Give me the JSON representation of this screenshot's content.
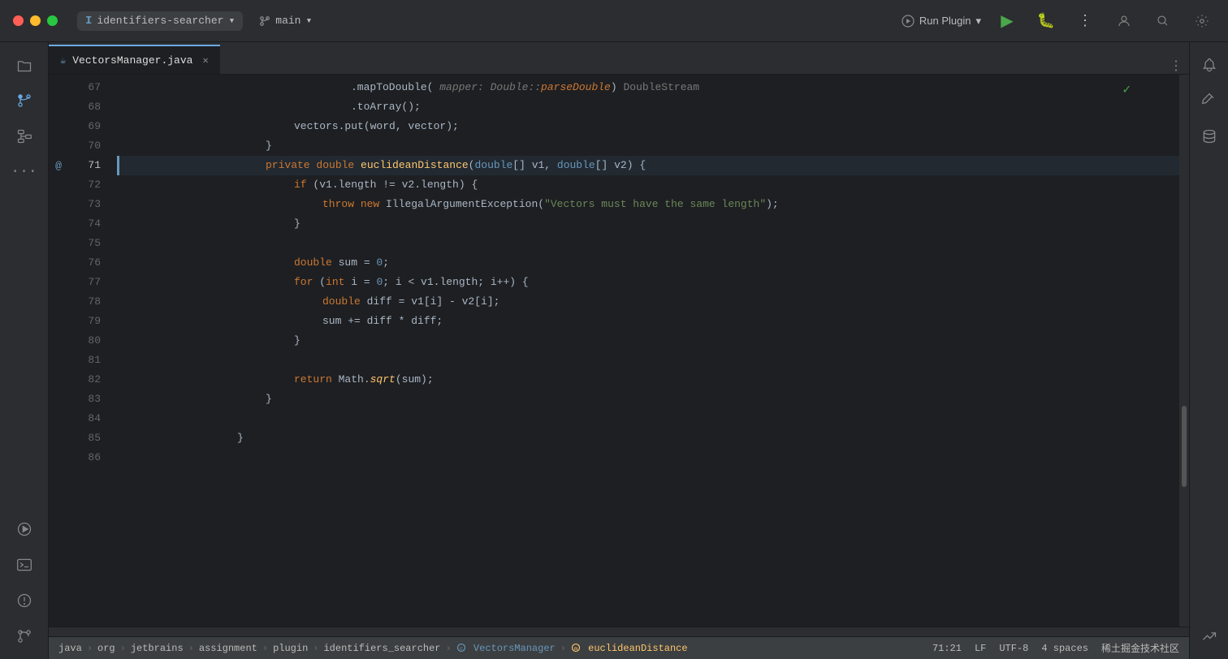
{
  "titlebar": {
    "project_name": "identifiers-searcher",
    "branch": "main",
    "run_plugin": "Run Plugin",
    "more_label": "⋮"
  },
  "tab": {
    "filename": "VectorsManager.java",
    "icon": "☕"
  },
  "code": {
    "lines": [
      {
        "num": 67,
        "content": "    .mapToDouble(",
        "hint": " mapper: Double::parseDouble",
        "hint2": ") DoubleStream",
        "active": false
      },
      {
        "num": 68,
        "content": "    .toArray();",
        "active": false
      },
      {
        "num": 69,
        "content": "  vectors.put(word, vector);",
        "active": false
      },
      {
        "num": 70,
        "content": "}",
        "active": false
      },
      {
        "num": 71,
        "content": "private double euclideanDistance(double[] v1, double[] v2) {",
        "active": false,
        "has_at": true,
        "is_method": true
      },
      {
        "num": 72,
        "content": "  if (v1.length != v2.length) {",
        "active": false
      },
      {
        "num": 73,
        "content": "    throw new IllegalArgumentException(\"Vectors must have the same length\");",
        "active": false
      },
      {
        "num": 74,
        "content": "  }",
        "active": false
      },
      {
        "num": 75,
        "content": "",
        "active": false
      },
      {
        "num": 76,
        "content": "  double sum = 0;",
        "active": false
      },
      {
        "num": 77,
        "content": "  for (int i = 0; i < v1.length; i++) {",
        "active": false
      },
      {
        "num": 78,
        "content": "    double diff = v1[i] - v2[i];",
        "active": false
      },
      {
        "num": 79,
        "content": "    sum += diff * diff;",
        "active": false
      },
      {
        "num": 80,
        "content": "  }",
        "active": false
      },
      {
        "num": 81,
        "content": "",
        "active": false
      },
      {
        "num": 82,
        "content": "  return Math.sqrt(sum);",
        "active": false
      },
      {
        "num": 83,
        "content": "}",
        "active": false
      },
      {
        "num": 84,
        "content": "",
        "active": false
      },
      {
        "num": 85,
        "content": "}",
        "active": false
      },
      {
        "num": 86,
        "content": "",
        "active": false
      }
    ]
  },
  "statusbar": {
    "breadcrumbs": [
      "java",
      "org",
      "jetbrains",
      "assignment",
      "plugin",
      "identifiers_searcher",
      "VectorsManager",
      "euclideanDistance"
    ],
    "cursor": "71:21",
    "line_ending": "LF",
    "encoding": "UTF-8",
    "indent": "4 spaces",
    "community": "稀土掘金技术社区"
  }
}
